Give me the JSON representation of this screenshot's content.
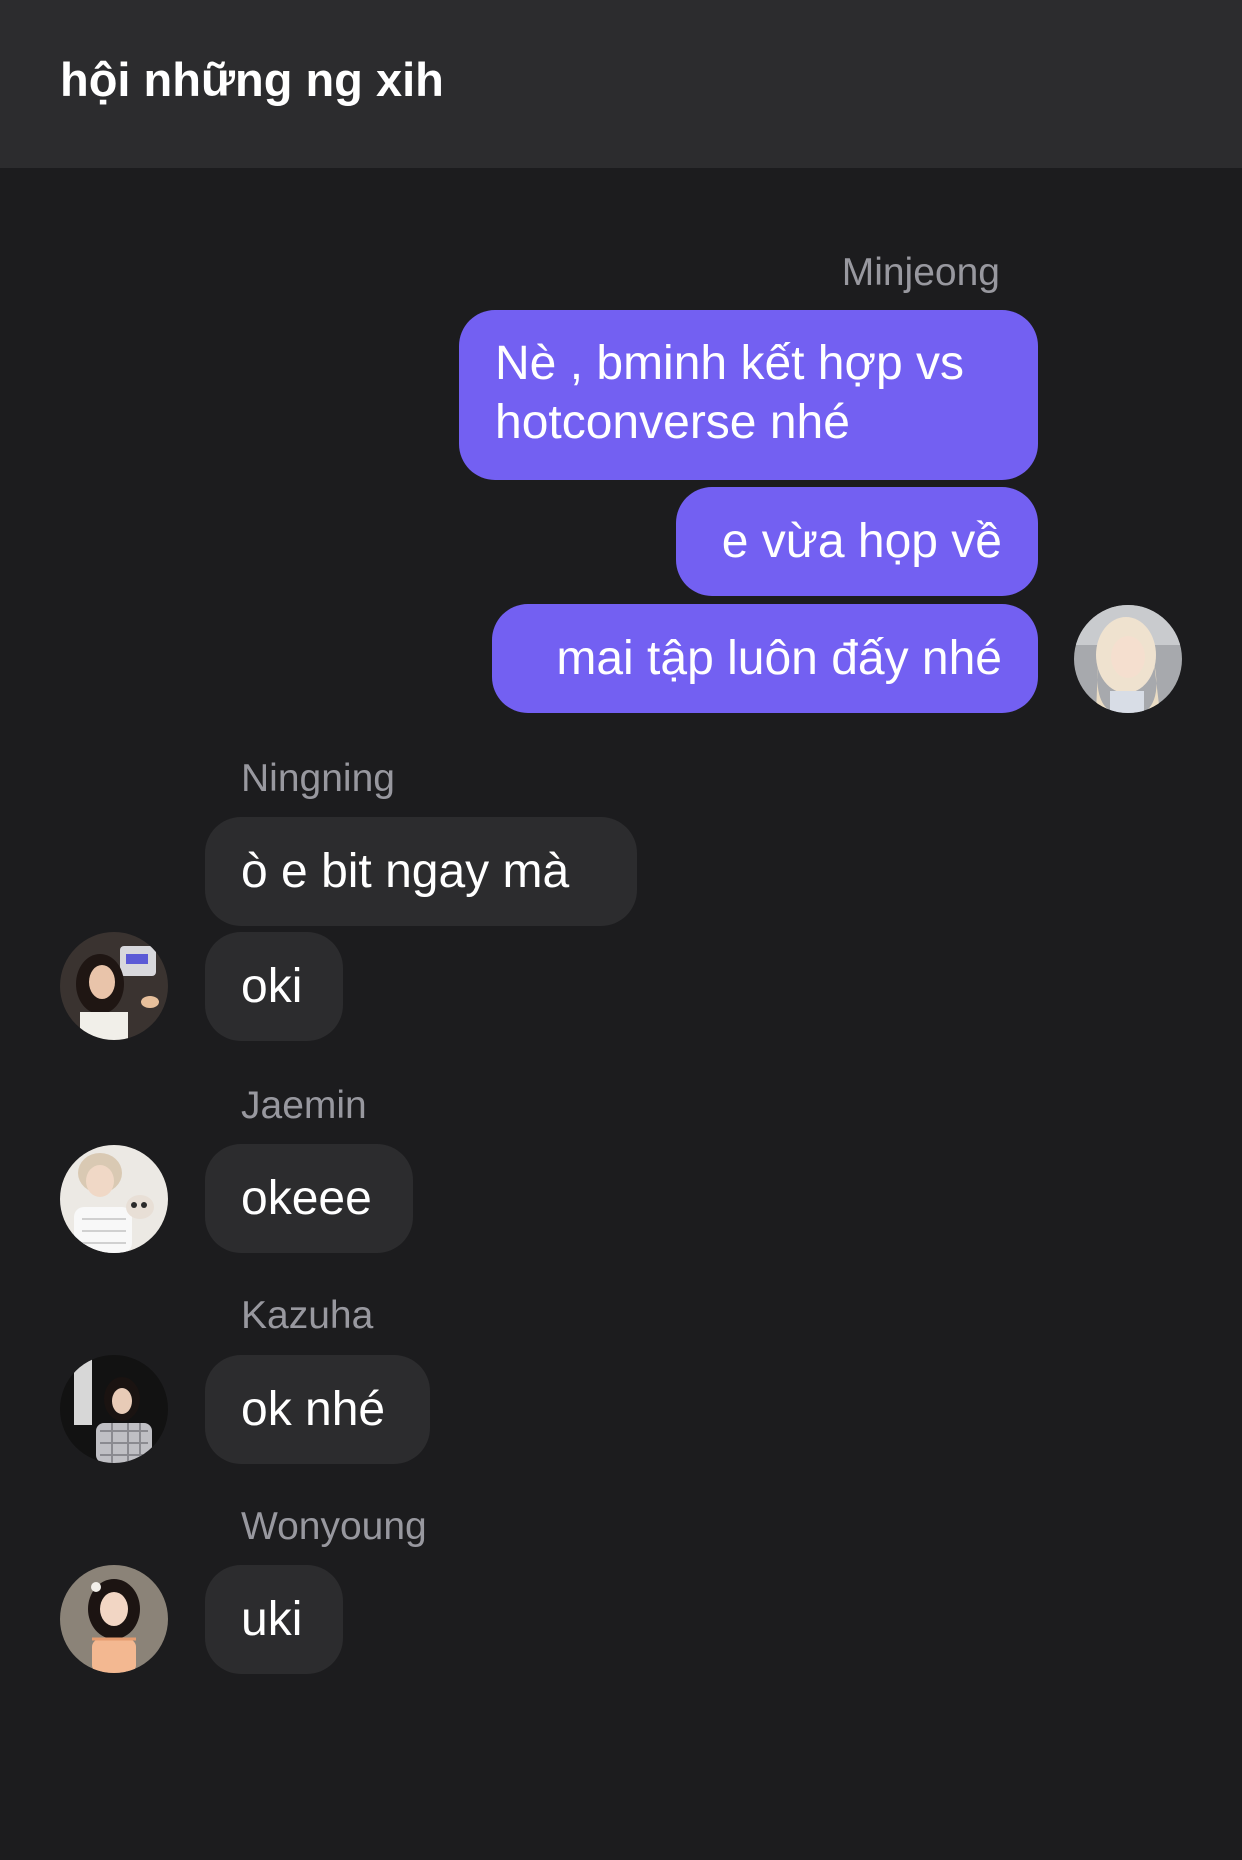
{
  "header": {
    "title": "hội những ng xih"
  },
  "colors": {
    "header_bg": "#2c2c2e",
    "chat_bg": "#1c1c1e",
    "outgoing_bubble": "#7360f2",
    "incoming_bubble": "#2c2c2e",
    "sender_name": "#98989f",
    "text": "#ffffff"
  },
  "outgoing": {
    "sender": "Minjeong",
    "avatar_icon": "user-avatar-icon",
    "messages": [
      {
        "line1": "Nè , bminh kết hợp vs",
        "line2": "hotconverse nhé"
      },
      {
        "text": "e vừa họp về"
      },
      {
        "text": "mai tập luôn đấy nhé"
      }
    ]
  },
  "groups": [
    {
      "sender": "Ningning",
      "avatar_icon": "user-avatar-icon",
      "messages": [
        "ò e bit ngay mà",
        "oki"
      ]
    },
    {
      "sender": "Jaemin",
      "avatar_icon": "user-avatar-icon",
      "messages": [
        "okeee"
      ]
    },
    {
      "sender": "Kazuha",
      "avatar_icon": "user-avatar-icon",
      "messages": [
        "ok nhé"
      ]
    },
    {
      "sender": "Wonyoung",
      "avatar_icon": "user-avatar-icon",
      "messages": [
        "uki"
      ]
    }
  ]
}
